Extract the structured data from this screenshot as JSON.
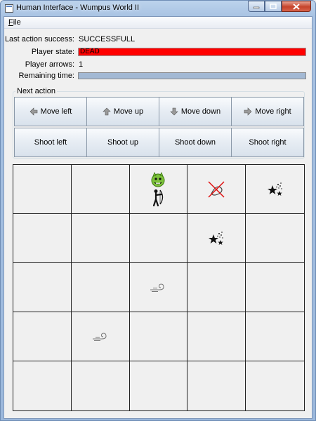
{
  "window": {
    "title": "Human Interface - Wumpus World II"
  },
  "menu": {
    "file_label_u": "F",
    "file_label_rest": "ile"
  },
  "status": {
    "last_action_label": "Last action success:",
    "last_action_value": "SUCCESSFULL",
    "player_state_label": "Player state:",
    "player_state_value": "DEAD",
    "player_arrows_label": "Player arrows:",
    "player_arrows_value": "1",
    "remaining_time_label": "Remaining time:",
    "remaining_time_fraction": 1.0
  },
  "next_action": {
    "title": "Next action",
    "move_left": "Move left",
    "move_up": "Move up",
    "move_down": "Move down",
    "move_right": "Move right",
    "shoot_left": "Shoot left",
    "shoot_up": "Shoot up",
    "shoot_down": "Shoot down",
    "shoot_right": "Shoot right"
  },
  "board": {
    "rows": 5,
    "cols": 5,
    "cells": [
      {
        "row": 0,
        "col": 2,
        "items": [
          "wumpus-icon",
          "archer-icon"
        ]
      },
      {
        "row": 0,
        "col": 3,
        "items": [
          "no-pit-icon"
        ]
      },
      {
        "row": 0,
        "col": 4,
        "items": [
          "stench-stars-icon"
        ]
      },
      {
        "row": 1,
        "col": 3,
        "items": [
          "stench-stars-icon"
        ]
      },
      {
        "row": 2,
        "col": 2,
        "items": [
          "breeze-icon"
        ]
      },
      {
        "row": 3,
        "col": 1,
        "items": [
          "breeze-icon"
        ]
      }
    ]
  },
  "colors": {
    "dead_state": "#ff0000",
    "time_bar": "#a3b9d4",
    "wumpus": "#7cc23a"
  }
}
